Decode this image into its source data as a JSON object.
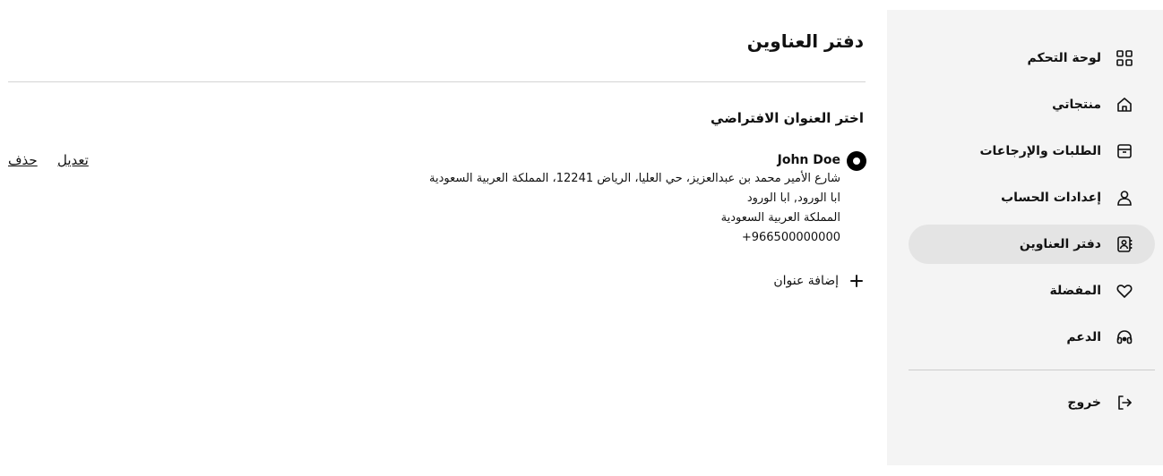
{
  "sidebar": {
    "items": [
      {
        "label": "لوحة التحكم",
        "icon": "grid-icon"
      },
      {
        "label": "منتجاتي",
        "icon": "home-icon"
      },
      {
        "label": "الطلبات والإرجاعات",
        "icon": "box-icon"
      },
      {
        "label": "إعدادات الحساب",
        "icon": "user-icon"
      },
      {
        "label": "دفتر العناوين",
        "icon": "address-book-icon",
        "active": true
      },
      {
        "label": "المفضلة",
        "icon": "heart-icon"
      },
      {
        "label": "الدعم",
        "icon": "headset-icon"
      }
    ],
    "logout": {
      "label": "خروج",
      "icon": "logout-icon"
    }
  },
  "main": {
    "title": "دفتر العناوين",
    "section_title": "اختر العنوان الافتراضي",
    "address": {
      "name": "John Doe",
      "lines": [
        "شارع الأمير محمد بن عبدالعزيز، حي العليا، الرياض 12241، المملكة العربية السعودية",
        "ابا الورود, ابا الورود",
        "المملكة العربية السعودية"
      ],
      "phone": "+966500000000",
      "selected": true
    },
    "edit_label": "تعديل",
    "delete_label": "حذف",
    "add_label": "إضافة عنوان"
  },
  "colors": {
    "sidebar_bg": "#f4f4f4",
    "active_item_bg": "#e4e4e4",
    "text": "#111111"
  }
}
